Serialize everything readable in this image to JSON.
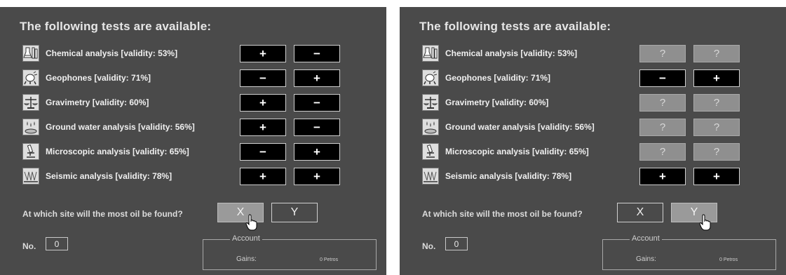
{
  "heading": "The following tests are available:",
  "tests": [
    {
      "label": "Chemical analysis [validity: 53%]",
      "icon": "flask-icon"
    },
    {
      "label": "Geophones [validity: 71%]",
      "icon": "geophone-icon"
    },
    {
      "label": "Gravimetry [validity: 60%]",
      "icon": "scale-icon"
    },
    {
      "label": "Ground water analysis [validity: 56%]",
      "icon": "water-drops-icon"
    },
    {
      "label": "Microscopic analysis [validity: 65%]",
      "icon": "microscope-icon"
    },
    {
      "label": "Seismic analysis [validity: 78%]",
      "icon": "seismic-icon"
    }
  ],
  "left": {
    "results": [
      [
        "+",
        "−"
      ],
      [
        "−",
        "+"
      ],
      [
        "+",
        "−"
      ],
      [
        "+",
        "−"
      ],
      [
        "−",
        "+"
      ],
      [
        "+",
        "+"
      ]
    ],
    "selected_choice": "X"
  },
  "right": {
    "results": [
      [
        "?",
        "?"
      ],
      [
        "−",
        "+"
      ],
      [
        "?",
        "?"
      ],
      [
        "?",
        "?"
      ],
      [
        "?",
        "?"
      ],
      [
        "+",
        "+"
      ]
    ],
    "selected_choice": "Y"
  },
  "question": "At which site will the most oil be found?",
  "choices": {
    "x": "X",
    "y": "Y"
  },
  "no_label": "No.",
  "no_value": "0",
  "account": {
    "title": "Account",
    "gains_label": "Gains:",
    "gains_value": "0 Petros"
  },
  "colors": {
    "panel": "#4a4a4a",
    "revealed_bg": "#000000",
    "hidden_bg": "#8f8f8f"
  }
}
